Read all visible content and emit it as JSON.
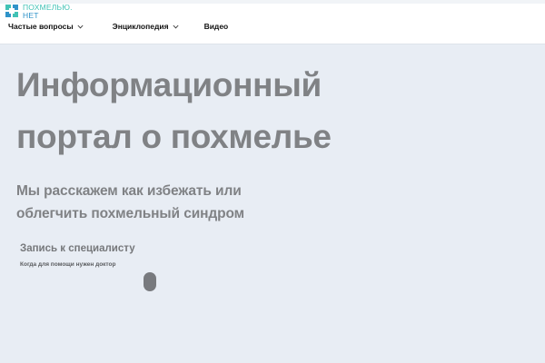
{
  "logo": {
    "line1": "ПОХМЕЛЬЮ.",
    "line2": "НЕТ",
    "icon": "cross-logo-icon",
    "colors": {
      "teal": "#41c2b5",
      "blue": "#2f93c9"
    }
  },
  "nav": {
    "items": [
      {
        "label": "Частые вопросы",
        "has_dropdown": true
      },
      {
        "label": "Энциклопедия",
        "has_dropdown": true
      },
      {
        "label": "Видео",
        "has_dropdown": false
      }
    ]
  },
  "hero": {
    "title": "Информационный портал о похмелье",
    "subtitle": "Мы расскажем как избежать или облегчить похмельный синдром"
  },
  "links": {
    "appointment": "Запись к специалисту",
    "when_doctor": "Когда для помощи нужен доктор"
  },
  "colors": {
    "background": "#e8edf4",
    "header": "#ffffff",
    "text_gray": "#808285"
  }
}
